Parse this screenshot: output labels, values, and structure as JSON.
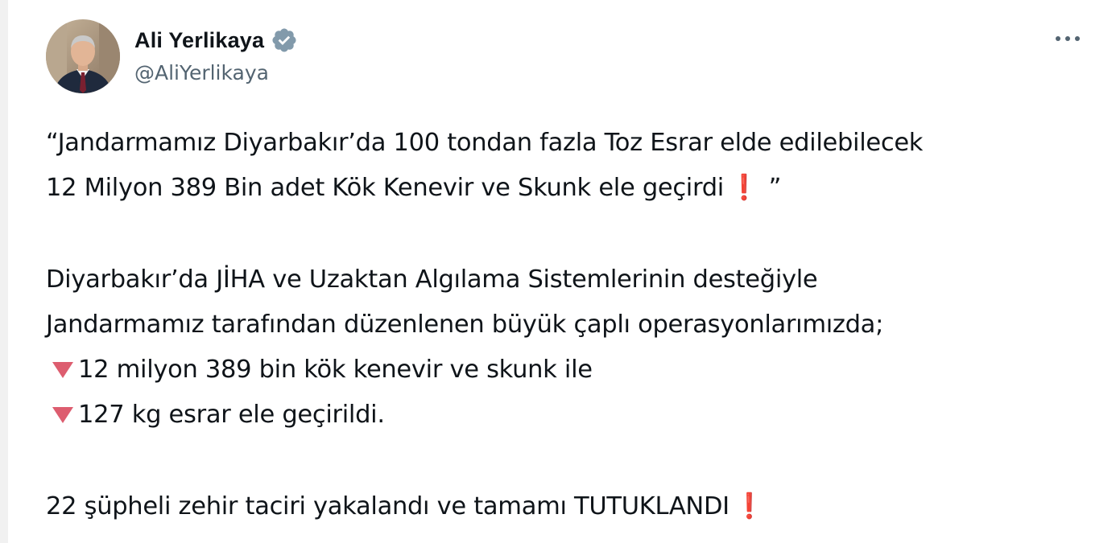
{
  "author": {
    "display_name": "Ali Yerlikaya",
    "handle": "@AliYerlikaya",
    "verified_icon": "verified-badge-icon"
  },
  "menu_icon": "more-options-icon",
  "colors": {
    "accent_red": "#e0245e",
    "triangle": "#dd5d6f",
    "handle_gray": "#536471",
    "verified_gray": "#829aab"
  },
  "tweet": {
    "quote_line1": "“Jandarmamız Diyarbakır’da 100 tondan fazla Toz Esrar elde edilebilecek",
    "quote_line2": "12 Milyon 389 Bin adet Kök Kenevir ve Skunk ele geçirdi",
    "quote_end": "”",
    "para_line1": "Diyarbakır’da JİHA ve Uzaktan Algılama Sistemlerinin desteğiyle",
    "para_line2": "Jandarmamız tarafından düzenlenen büyük çaplı operasyonlarımızda;",
    "bullet1": "12 milyon 389 bin kök kenevir ve skunk ile",
    "bullet2": "127 kg esrar ele geçirildi.",
    "final_line": "22 şüpheli zehir taciri yakalandı ve tamamı TUTUKLANDI",
    "exclamation": "❗"
  }
}
